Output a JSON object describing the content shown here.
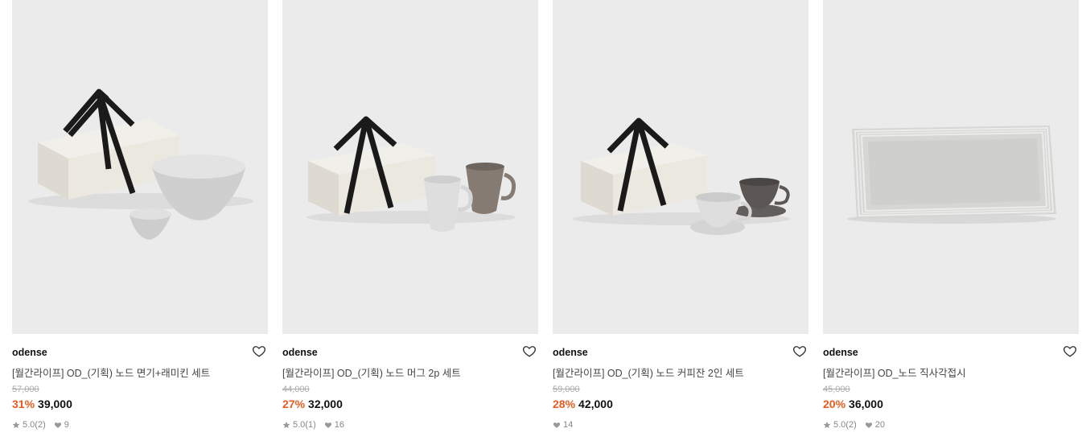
{
  "products": [
    {
      "brand": "odense",
      "title": "[월간라이프] OD_(기획) 노드 면기+래미킨 세트",
      "original_price": "57,000",
      "discount": "31%",
      "price": "39,000",
      "rating": "5.0",
      "reviews": "(2)",
      "likes": "9"
    },
    {
      "brand": "odense",
      "title": "[월간라이프] OD_(기획) 노드 머그 2p 세트",
      "original_price": "44,000",
      "discount": "27%",
      "price": "32,000",
      "rating": "5.0",
      "reviews": "(1)",
      "likes": "16"
    },
    {
      "brand": "odense",
      "title": "[월간라이프] OD_(기획) 노드 커피잔 2인 세트",
      "original_price": "59,000",
      "discount": "28%",
      "price": "42,000",
      "likes": "14"
    },
    {
      "brand": "odense",
      "title": "[월간라이프] OD_노드 직사각접시",
      "original_price": "45,000",
      "discount": "20%",
      "price": "36,000",
      "rating": "5.0",
      "reviews": "(2)",
      "likes": "20"
    }
  ],
  "icons": {
    "wishlist": "heart-outline-icon",
    "rating": "star-icon",
    "likes": "heart-filled-icon"
  },
  "colors": {
    "discount": "#e85b20",
    "thumb_bg": "#ebebeb"
  }
}
